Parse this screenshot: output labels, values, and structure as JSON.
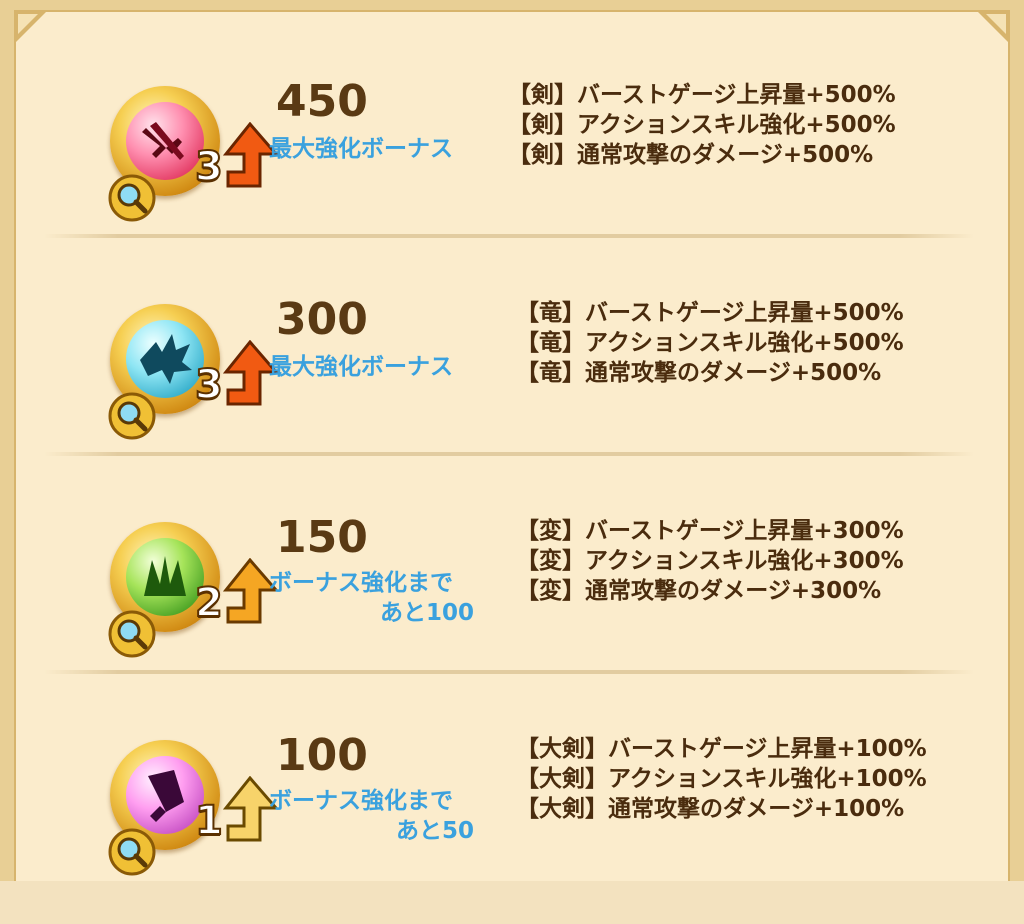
{
  "rows": [
    {
      "value": "450",
      "bonus_line1": "最大強化ボーナス",
      "bonus_line2": "",
      "level": "3",
      "orb_icon": "sword-orb-icon",
      "gem_color": "#e0305a",
      "effects": [
        "【剣】バーストゲージ上昇量+500%",
        "【剣】アクションスキル強化+500%",
        "【剣】通常攻撃のダメージ+500%"
      ]
    },
    {
      "value": "300",
      "bonus_line1": "最大強化ボーナス",
      "bonus_line2": "",
      "level": "3",
      "orb_icon": "dragon-orb-icon",
      "gem_color": "#2aa7c6",
      "effects": [
        "【竜】バーストゲージ上昇量+500%",
        "【竜】アクションスキル強化+500%",
        "【竜】通常攻撃のダメージ+500%"
      ]
    },
    {
      "value": "150",
      "bonus_line1": "ボーナス強化まで",
      "bonus_line2": "あと100",
      "level": "2",
      "orb_icon": "transform-orb-icon",
      "gem_color": "#3f9a1e",
      "effects": [
        "【変】バーストゲージ上昇量+300%",
        "【変】アクションスキル強化+300%",
        "【変】通常攻撃のダメージ+300%"
      ]
    },
    {
      "value": "100",
      "bonus_line1": "ボーナス強化まで",
      "bonus_line2": "あと50",
      "level": "1",
      "orb_icon": "greatsword-orb-icon",
      "gem_color": "#c24ac0",
      "effects": [
        "【大剣】バーストゲージ上昇量+100%",
        "【大剣】アクションスキル強化+100%",
        "【大剣】通常攻撃のダメージ+100%"
      ]
    }
  ],
  "colors": {
    "value_text": "#5a3a14",
    "bonus_text": "#3aa1de",
    "effect_text": "#4a2c0e",
    "panel_bg": "#fbeccc",
    "frame": "#e8cf95"
  },
  "icons": {
    "search": "magnifier-icon",
    "level_up": "up-arrow-icon"
  }
}
